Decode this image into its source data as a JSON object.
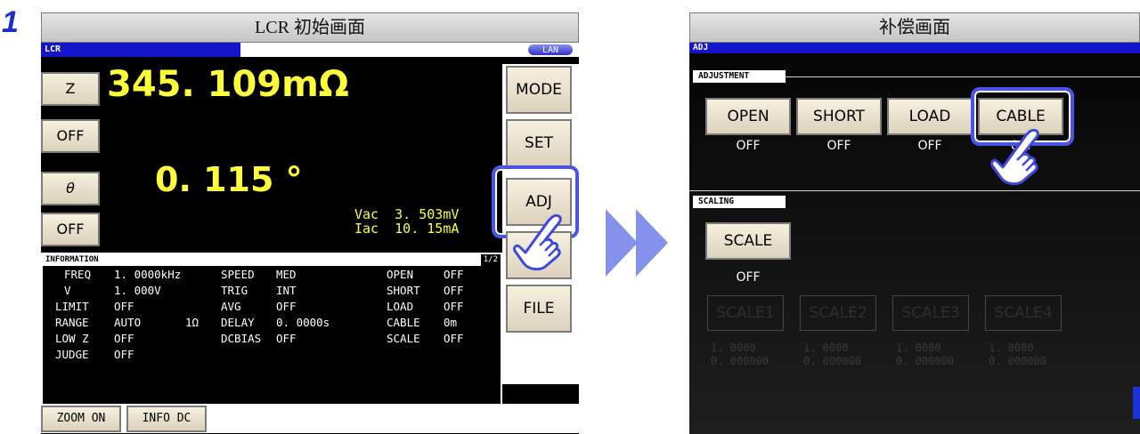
{
  "step": "1",
  "left": {
    "caption": "LCR 初始画面",
    "screen_title": "LCR",
    "lan_badge": "LAN",
    "param_buttons": [
      "Z",
      "OFF",
      "θ",
      "OFF"
    ],
    "value1": "345. 109mΩ",
    "value2": "0. 115  °",
    "vac_line": "Vac  3. 503mV",
    "iac_line": "Iac  10. 15mA",
    "menu_buttons": [
      "MODE",
      "SET",
      "ADJ",
      "SYS",
      "FILE"
    ],
    "info": {
      "title": "INFORMATION",
      "page": "1/2",
      "rows": [
        [
          "FREQ",
          "1. 0000kHz",
          "",
          "SPEED",
          "MED",
          "OPEN",
          "OFF"
        ],
        [
          "V",
          "1. 000V",
          "",
          "TRIG",
          "INT",
          "SHORT",
          "OFF"
        ],
        [
          "LIMIT",
          "OFF",
          "",
          "AVG",
          "OFF",
          "LOAD",
          "OFF"
        ],
        [
          "RANGE",
          "AUTO",
          "1Ω",
          "DELAY",
          "0. 0000s",
          "CABLE",
          "0m"
        ],
        [
          "LOW Z",
          "OFF",
          "",
          "DCBIAS",
          "OFF",
          "SCALE",
          "OFF"
        ],
        [
          "JUDGE",
          "OFF",
          "",
          "",
          "",
          "",
          ""
        ]
      ]
    },
    "bottom_buttons": [
      "ZOOM ON",
      "INFO DC"
    ]
  },
  "right": {
    "caption": "补偿画面",
    "screen_title": "ADJ",
    "adjustment_label": "ADJUSTMENT",
    "adj_buttons": [
      {
        "label": "OPEN",
        "value": "OFF"
      },
      {
        "label": "SHORT",
        "value": "OFF"
      },
      {
        "label": "LOAD",
        "value": "OFF"
      },
      {
        "label": "CABLE",
        "value": "0m"
      }
    ],
    "scaling_label": "SCALING",
    "scale_button": {
      "label": "SCALE",
      "value": "OFF"
    },
    "scale_slots": [
      {
        "label": "SCALE1",
        "a": "1. 0000",
        "b": "0. 000000"
      },
      {
        "label": "SCALE2",
        "a": "1. 0000",
        "b": "0. 000000"
      },
      {
        "label": "SCALE3",
        "a": "1. 0000",
        "b": "0. 000000"
      },
      {
        "label": "SCALE4",
        "a": "1. 0000",
        "b": "0. 000000"
      }
    ]
  },
  "colors": {
    "highlight": "#4a55e8",
    "value_yellow": "#ffff3a",
    "title_blue": "#1414c8"
  }
}
